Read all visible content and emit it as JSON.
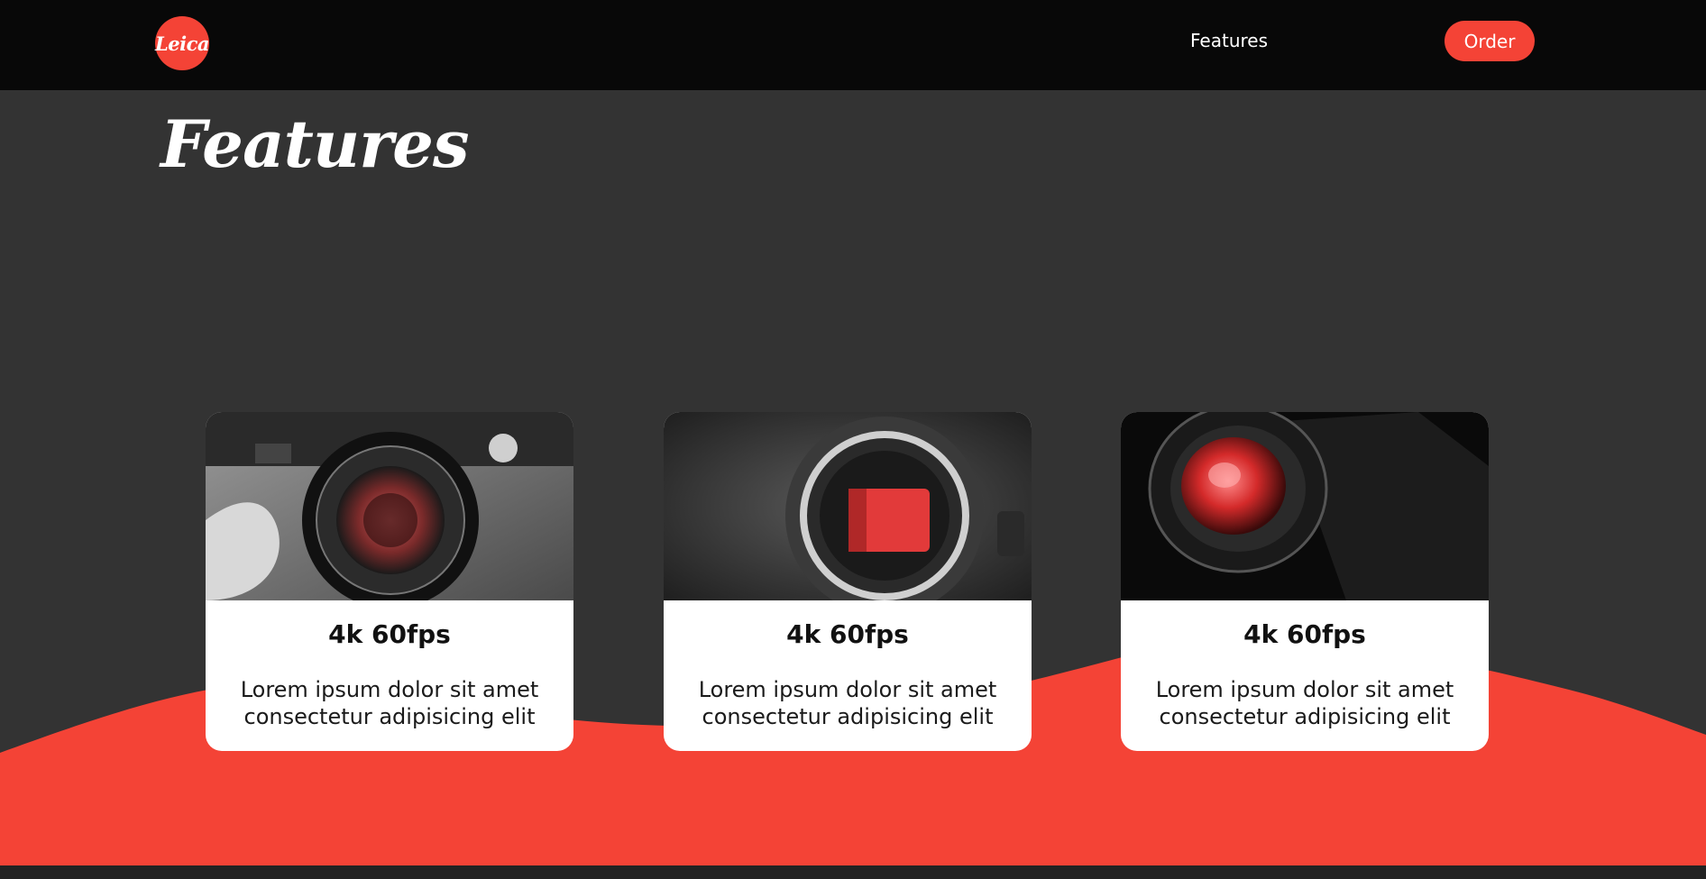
{
  "nav": {
    "logo_text": "Leica",
    "features_link": "Features",
    "order_button": "Order"
  },
  "page": {
    "title": "Features"
  },
  "cards": [
    {
      "title": "4k 60fps",
      "description": "Lorem ipsum dolor sit amet consectetur adipisicing elit"
    },
    {
      "title": "4k 60fps",
      "description": "Lorem ipsum dolor sit amet consectetur adipisicing elit"
    },
    {
      "title": "4k 60fps",
      "description": "Lorem ipsum dolor sit amet consectetur adipisicing elit"
    }
  ],
  "colors": {
    "accent": "#f44336",
    "background": "#333333",
    "nav_background": "#080808",
    "card_background": "#ffffff"
  }
}
